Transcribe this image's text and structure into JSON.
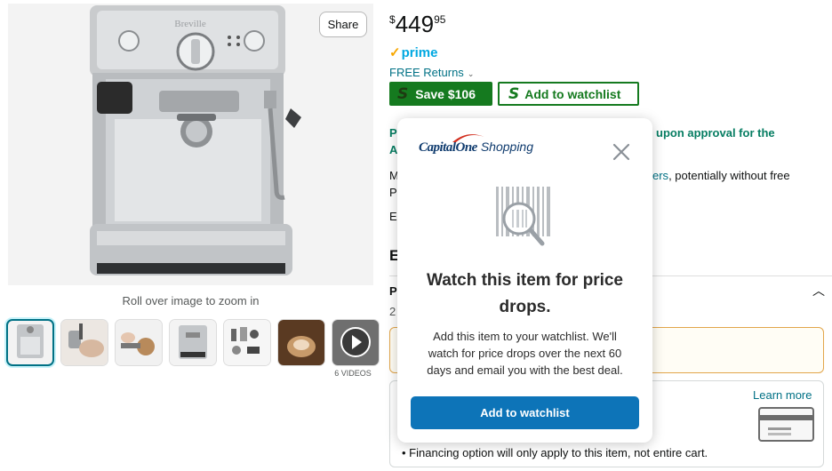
{
  "gallery": {
    "share_label": "Share",
    "zoom_hint": "Roll over image to zoom in",
    "brand_mark": "Breville",
    "videos_label": "6 VIDEOS",
    "thumbnails": [
      "machine-front",
      "milk-frothing",
      "tamping",
      "machine-side",
      "accessories",
      "latte",
      "video"
    ]
  },
  "product": {
    "price_symbol": "$",
    "price_whole": "449",
    "price_fraction": "95",
    "prime_label": "prime",
    "free_returns": "FREE Returns",
    "save_label": "Save $106",
    "watch_label": "Add to watchlist"
  },
  "background_text": {
    "line1_prefix": "P",
    "line1_suffix": "upon approval for the",
    "line2_prefix": "A",
    "line3_prefix": "M",
    "line3_suffix_link": "ers",
    "line3_suffix_rest": ", potentially without free",
    "line4_prefix": "P",
    "line5_prefix": "E",
    "section_prefix": "E",
    "row1_prefix": "P",
    "row2_prefix": "2",
    "learn_more": "Learn more",
    "financing_note": "Financing option will only apply to this item, not entire cart."
  },
  "modal": {
    "brand_capital": "CapitalOne",
    "brand_shopping": "Shopping",
    "title": "Watch this item for price drops.",
    "body": "Add this item to your watchlist. We'll watch for price drops over the next 60 days and email you with the best deal.",
    "cta_label": "Add to watchlist"
  },
  "colors": {
    "green": "#157a1f",
    "link": "#007185",
    "capital_blue": "#0f3b6e",
    "cta_blue": "#0d74b8",
    "prime_blue": "#00a8e1"
  }
}
